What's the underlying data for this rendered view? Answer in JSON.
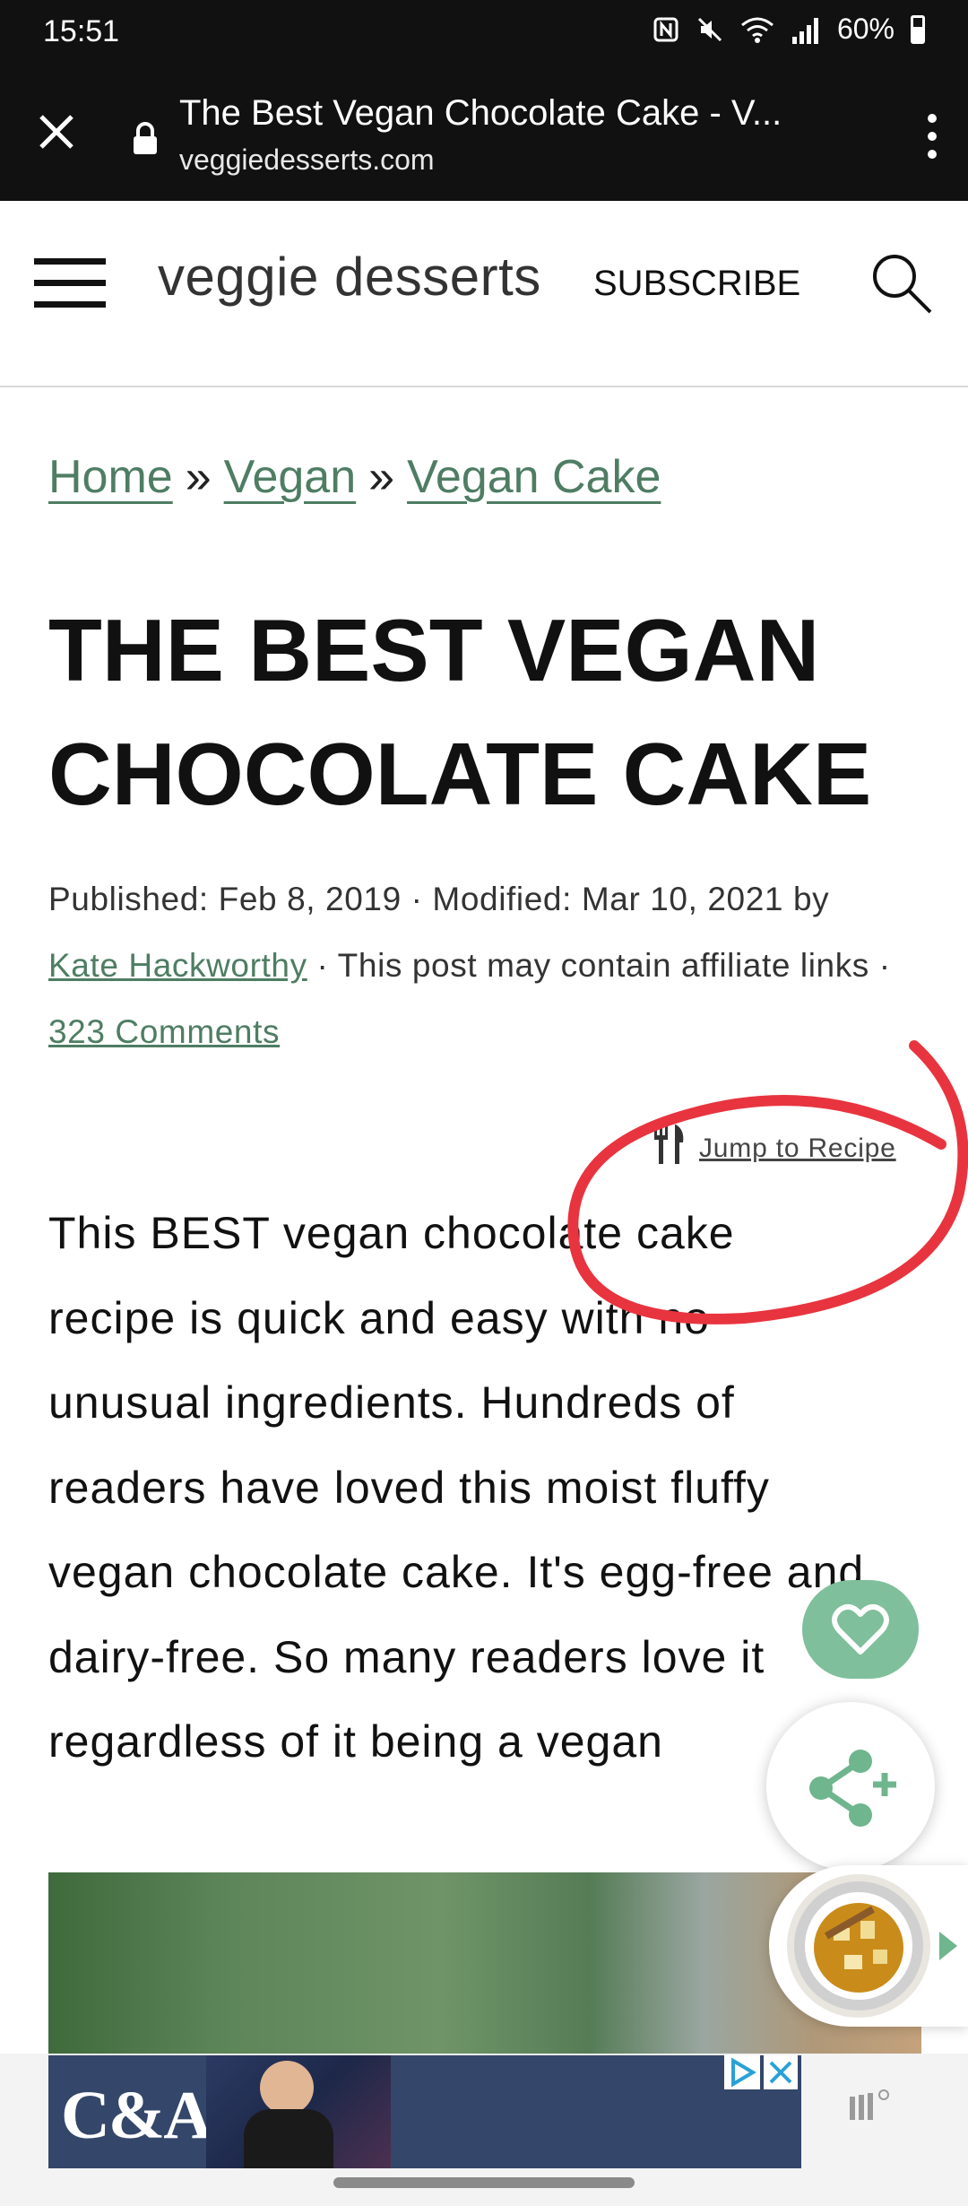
{
  "status_bar": {
    "time": "15:51",
    "battery": "60%",
    "icons": [
      "nfc-icon",
      "mute-icon",
      "wifi-icon",
      "signal-icon",
      "battery-icon"
    ]
  },
  "browser": {
    "page_title": "The Best Vegan Chocolate Cake - V...",
    "domain": "veggiedesserts.com"
  },
  "header": {
    "logo": "veggie desserts",
    "subscribe": "SUBSCRIBE"
  },
  "breadcrumb": {
    "items": [
      "Home",
      "Vegan",
      "Vegan Cake"
    ],
    "separator": "»"
  },
  "article": {
    "title": "THE BEST VEGAN CHOCOLATE CAKE",
    "meta": {
      "published": "Published: Feb 8, 2019 · Modified: Mar 10, 2021 by",
      "author": "Kate Hackworthy",
      "affiliate": " · This post may contain affiliate links · ",
      "comments": "323 Comments"
    },
    "jump_to_recipe": "Jump to Recipe",
    "intro": "This BEST vegan chocolate cake recipe is quick and easy with no unusual ingredients. Hundreds of readers have loved this moist fluffy vegan chocolate cake. It's egg-free and dairy-free. So many readers love it regardless of it being a vegan"
  },
  "ad": {
    "brand": "C&A"
  },
  "colors": {
    "link_green": "#4e7d63",
    "fab_green": "#7fbf9b",
    "annotation_red": "#e8343f",
    "chrome_dark": "#111111"
  }
}
